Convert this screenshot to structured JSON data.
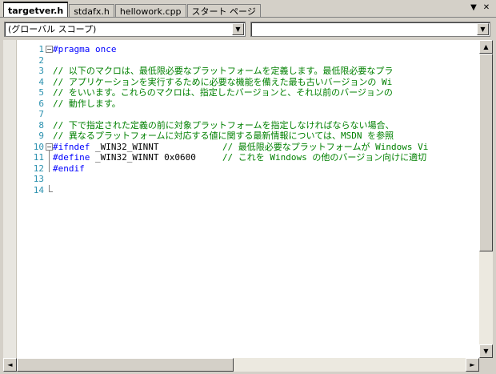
{
  "tabs": [
    {
      "label": "targetver.h",
      "active": true
    },
    {
      "label": "stdafx.h",
      "active": false
    },
    {
      "label": "hellowork.cpp",
      "active": false
    },
    {
      "label": "スタート ページ",
      "active": false
    }
  ],
  "tab_controls": {
    "dropdown_glyph": "▼",
    "close_glyph": "✕"
  },
  "scope_combo": {
    "value": "(グローバル スコープ)"
  },
  "member_combo": {
    "value": ""
  },
  "editor": {
    "line_numbers": [
      "1",
      "2",
      "3",
      "4",
      "5",
      "6",
      "7",
      "8",
      "9",
      "10",
      "11",
      "12",
      "13",
      "14"
    ],
    "lines": [
      [
        {
          "t": "#pragma once",
          "c": "kw"
        }
      ],
      [
        {
          "t": "",
          "c": ""
        }
      ],
      [
        {
          "t": "// 以下のマクロは、最低限必要なプラットフォームを定義します。最低限必要なプラ",
          "c": "cm"
        }
      ],
      [
        {
          "t": "// アプリケーションを実行するために必要な機能を備えた最も古いバージョンの Wi",
          "c": "cm"
        }
      ],
      [
        {
          "t": "// をいいます。これらのマクロは、指定したバージョンと、それ以前のバージョンの",
          "c": "cm"
        }
      ],
      [
        {
          "t": "// 動作します。",
          "c": "cm"
        }
      ],
      [
        {
          "t": "",
          "c": ""
        }
      ],
      [
        {
          "t": "// 下で指定された定義の前に対象プラットフォームを指定しなければならない場合、",
          "c": "cm"
        }
      ],
      [
        {
          "t": "// 異なるプラットフォームに対応する値に関する最新情報については、MSDN を参照",
          "c": "cm"
        }
      ],
      [
        {
          "t": "#ifndef",
          "c": "kw"
        },
        {
          "t": " _WIN32_WINNT            ",
          "c": ""
        },
        {
          "t": "// 最低限必要なプラットフォームが Windows Vi",
          "c": "cm"
        }
      ],
      [
        {
          "t": "#define",
          "c": "kw"
        },
        {
          "t": " _WIN32_WINNT 0x0600     ",
          "c": ""
        },
        {
          "t": "// これを Windows の他のバージョン向けに適切",
          "c": "cm"
        }
      ],
      [
        {
          "t": "#endif",
          "c": "kw"
        }
      ],
      [
        {
          "t": "",
          "c": ""
        }
      ],
      [
        {
          "t": "",
          "c": ""
        }
      ]
    ],
    "fold_markers": [
      {
        "line": 1,
        "glyph": "−"
      },
      {
        "line": 10,
        "glyph": "−"
      }
    ]
  },
  "scrollbar": {
    "up_glyph": "▲",
    "down_glyph": "▼",
    "left_glyph": "◄",
    "right_glyph": "►"
  },
  "colors": {
    "keyword": "#0000ff",
    "comment": "#008000",
    "line_number": "#2b91af"
  }
}
